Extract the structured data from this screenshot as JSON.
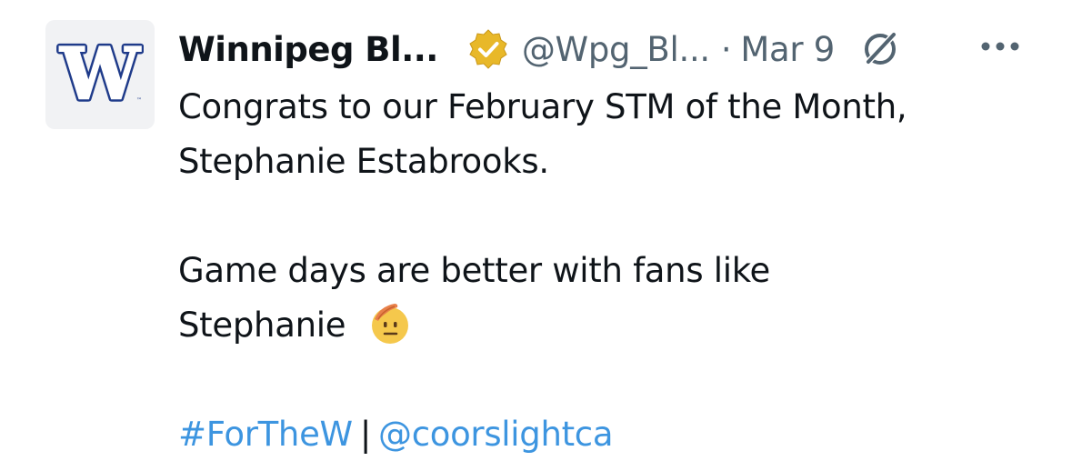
{
  "author": {
    "display_name": "Winnipeg Bl...",
    "handle": "@Wpg_Bl...",
    "separator": "·",
    "date": "Mar 9",
    "avatar_letter": "W"
  },
  "icons": {
    "verified": "verified-badge-icon",
    "grok": "grok-icon",
    "more": "more-options-icon",
    "emoji": "saluting-face-emoji"
  },
  "colors": {
    "link": "#3d95e0",
    "verified_gold": "#e8b829",
    "muted": "#536471",
    "avatar_navy": "#1f3b8a"
  },
  "tweet": {
    "line1": "Congrats to our February STM of the Month,",
    "line2": "Stephanie Estabrooks.",
    "line3": "Game days are better with fans like",
    "line4": "Stephanie",
    "hashtag": "#ForTheW",
    "pipe": "|",
    "mention": "@coorslightca"
  }
}
